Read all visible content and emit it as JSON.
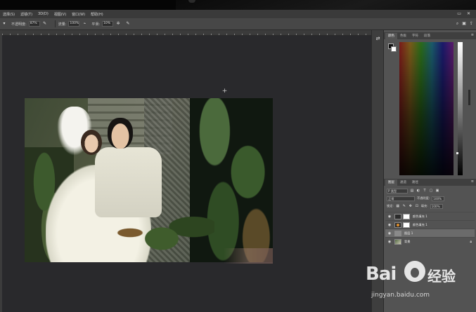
{
  "menu": {
    "items": [
      "选择(S)",
      "滤镜(T)",
      "3D(D)",
      "视图(V)",
      "窗口(W)",
      "帮助(H)"
    ],
    "win_controls": [
      "▭",
      "✕"
    ]
  },
  "options": {
    "opacity_label": "不透明度:",
    "opacity_value": "87%",
    "flow_label": "流量:",
    "flow_value": "100%",
    "smooth_label": "平滑:",
    "smooth_value": "10%"
  },
  "panels": {
    "color_tabs": [
      "颜色",
      "色板",
      "字符",
      "段落"
    ],
    "layers_tabs": [
      "图层",
      "通道",
      "路径"
    ],
    "filter_kind": "P 类型",
    "blend_mode": "正常",
    "opacity_label": "不透明度:",
    "opacity_value": "100%",
    "lock_label": "锁定:",
    "fill_label": "填充:",
    "fill_value": "100%"
  },
  "layers": [
    {
      "name": "颜色填充 1",
      "thumb": "adj",
      "has_mask": true,
      "selected": false
    },
    {
      "name": "颜色填充 1",
      "thumb": "adj2",
      "has_mask": true,
      "selected": false
    },
    {
      "name": "图层 1",
      "thumb": "blank",
      "has_mask": false,
      "selected": true
    },
    {
      "name": "背景",
      "thumb": "photo",
      "has_mask": false,
      "selected": false,
      "locked": true
    }
  ],
  "watermark": {
    "brand": "Bai",
    "brand2": "经验",
    "url": "jingyan.baidu.com"
  },
  "colors": {
    "canvas_bg": "#29292c",
    "panel_bg": "#535353",
    "menubar_bg": "#3a3a3a"
  }
}
